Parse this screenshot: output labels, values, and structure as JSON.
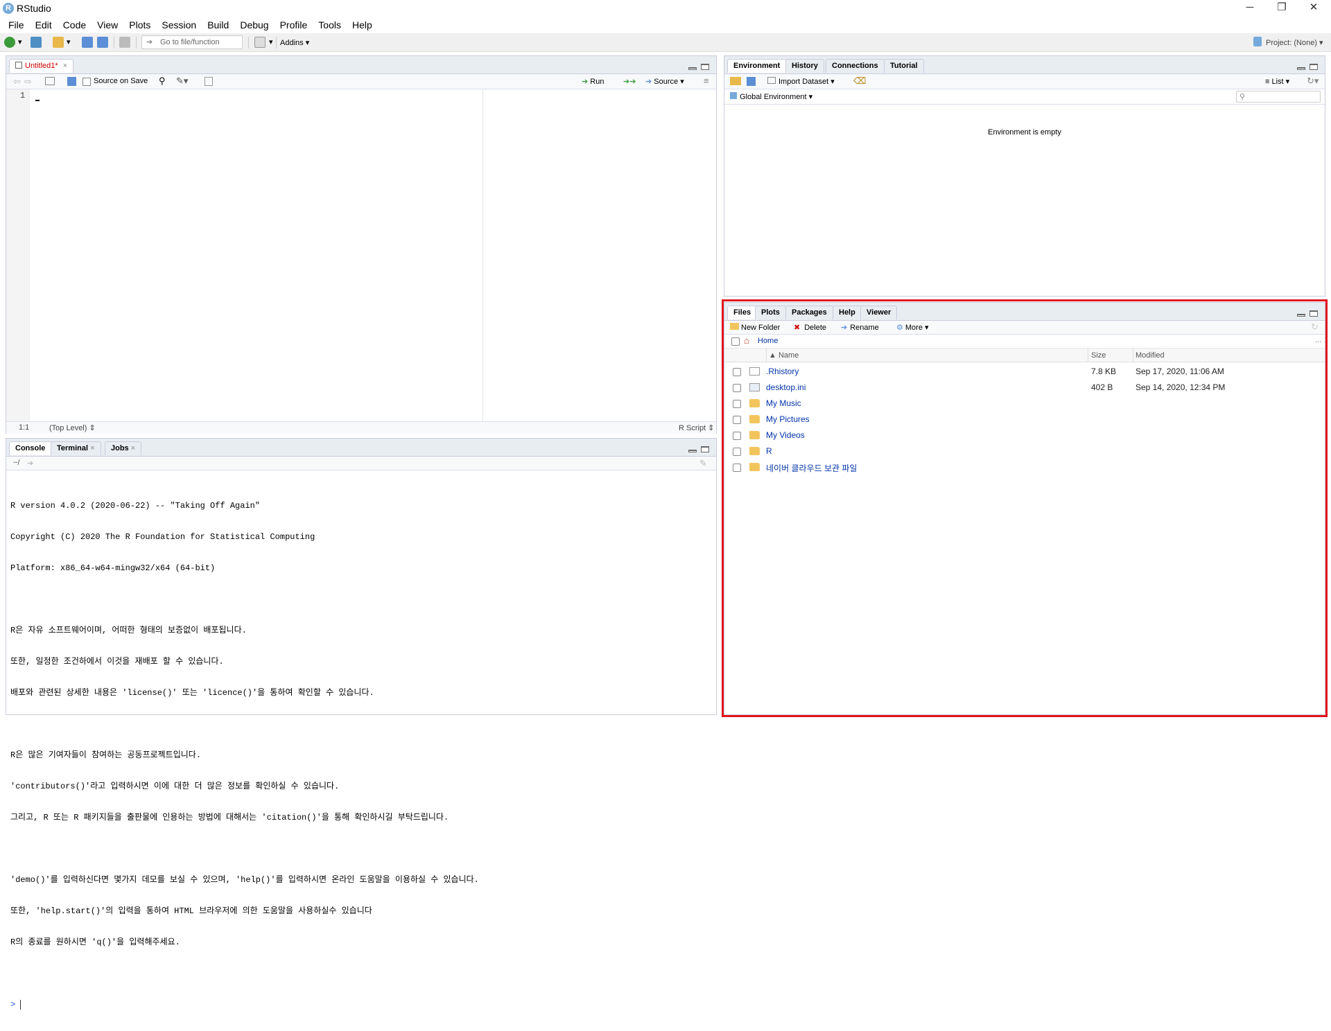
{
  "window": {
    "title": "RStudio",
    "logo": "R",
    "controls": [
      "─",
      "❐",
      "✕"
    ]
  },
  "menu": [
    "File",
    "Edit",
    "Code",
    "View",
    "Plots",
    "Session",
    "Build",
    "Debug",
    "Profile",
    "Tools",
    "Help"
  ],
  "toolbar": {
    "goto_placeholder": "Go to file/function",
    "addins": "Addins",
    "project": "Project: (None)"
  },
  "editor": {
    "tab": "Untitled1*",
    "source_on_save": "Source on Save",
    "run": "Run",
    "source": "Source",
    "line_number": "1",
    "cursor_pos": "1:1",
    "scope": "(Top Level)",
    "file_type": "R Script"
  },
  "console": {
    "tabs": [
      "Console",
      "Terminal",
      "Jobs"
    ],
    "path": "~/",
    "lines": [
      "R version 4.0.2 (2020-06-22) -- \"Taking Off Again\"",
      "Copyright (C) 2020 The R Foundation for Statistical Computing",
      "Platform: x86_64-w64-mingw32/x64 (64-bit)",
      "",
      "R은 자유 소프트웨어이며, 어떠한 형태의 보증없이 배포됩니다.",
      "또한, 일정한 조건하에서 이것을 재배포 할 수 있습니다.",
      "배포와 관련된 상세한 내용은 'license()' 또는 'licence()'을 통하여 확인할 수 있습니다.",
      "",
      "R은 많은 기여자들이 참여하는 공동프로젝트입니다.",
      "'contributors()'라고 입력하시면 이에 대한 더 많은 정보를 확인하실 수 있습니다.",
      "그리고, R 또는 R 패키지들을 출판물에 인용하는 방법에 대해서는 'citation()'을 통해 확인하시길 부탁드립니다.",
      "",
      "'demo()'를 입력하신다면 몇가지 데모를 보실 수 있으며, 'help()'를 입력하시면 온라인 도움말을 이용하실 수 있습니다.",
      "또한, 'help.start()'의 입력을 통하여 HTML 브라우저에 의한 도움말을 사용하실수 있습니다",
      "R의 종료를 원하시면 'q()'을 입력해주세요."
    ],
    "prompt": ">"
  },
  "environment": {
    "tabs": [
      "Environment",
      "History",
      "Connections",
      "Tutorial"
    ],
    "import_dataset": "Import Dataset",
    "list": "List",
    "global_env": "Global Environment",
    "empty_msg": "Environment is empty"
  },
  "files": {
    "tabs": [
      "Files",
      "Plots",
      "Packages",
      "Help",
      "Viewer"
    ],
    "new_folder": "New Folder",
    "delete": "Delete",
    "rename": "Rename",
    "more": "More",
    "breadcrumb": "Home",
    "more_dots": "...",
    "headers": {
      "name": "Name",
      "size": "Size",
      "modified": "Modified"
    },
    "rows": [
      {
        "name": ".Rhistory",
        "size": "7.8 KB",
        "modified": "Sep 17, 2020, 11:06 AM",
        "icon": "document-icon"
      },
      {
        "name": "desktop.ini",
        "size": "402 B",
        "modified": "Sep 14, 2020, 12:34 PM",
        "icon": "settings-file-icon"
      },
      {
        "name": "My Music",
        "size": "",
        "modified": "",
        "icon": "folder-icon"
      },
      {
        "name": "My Pictures",
        "size": "",
        "modified": "",
        "icon": "folder-icon"
      },
      {
        "name": "My Videos",
        "size": "",
        "modified": "",
        "icon": "folder-icon"
      },
      {
        "name": "R",
        "size": "",
        "modified": "",
        "icon": "folder-icon"
      },
      {
        "name": "네이버 클라우드 보관 파일",
        "size": "",
        "modified": "",
        "icon": "folder-icon"
      }
    ]
  },
  "highlight_color": "#e0141e"
}
